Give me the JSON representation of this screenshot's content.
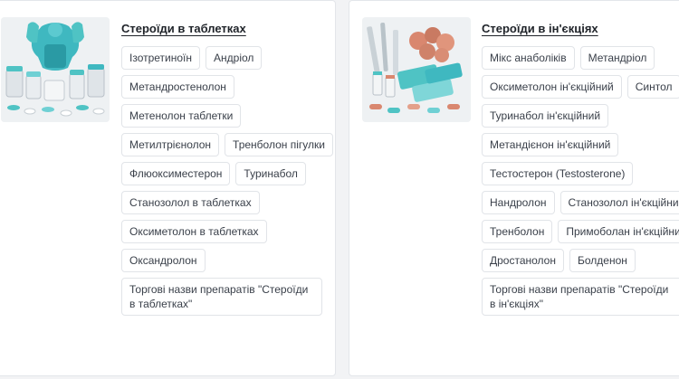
{
  "categories": [
    {
      "title": "Стероїди в таблетках",
      "image_icon": "muscular-figure-with-pill-bottles-icon",
      "tags": [
        "Ізотретиноїн",
        "Андріол",
        "Метандростенолон",
        "Метенолон таблетки",
        "Метилтрієнолон",
        "Тренболон пігулки",
        "Флюоксиместерон",
        "Туринабол",
        "Станозолол в таблетках",
        "Оксиметолон в таблетках",
        "Оксандролон",
        "Торгові назви препаратів \"Стероїди в таблетках\""
      ]
    },
    {
      "title": "Стероїди в ін'єкціях",
      "image_icon": "injection-vials-and-pills-icon",
      "tags": [
        "Мікс анаболіків",
        "Метандріол",
        "Оксиметолон ін'єкційний",
        "Синтол",
        "Туринабол ін'єкційний",
        "Метандієнон ін'єкційний",
        "Тестостерон (Testosterone)",
        "Нандролон",
        "Станозолол ін'єкційний",
        "Тренболон",
        "Примоболан ін'єкційний",
        "Дростанолон",
        "Болденон",
        "Торгові назви препаратів \"Стероїди в ін'єкціях\""
      ]
    }
  ],
  "colors": {
    "page_bg": "#f2f3f5",
    "card_bg": "#ffffff",
    "tag_border": "#e1e4e8",
    "accent_teal": "#4fc3c4"
  }
}
